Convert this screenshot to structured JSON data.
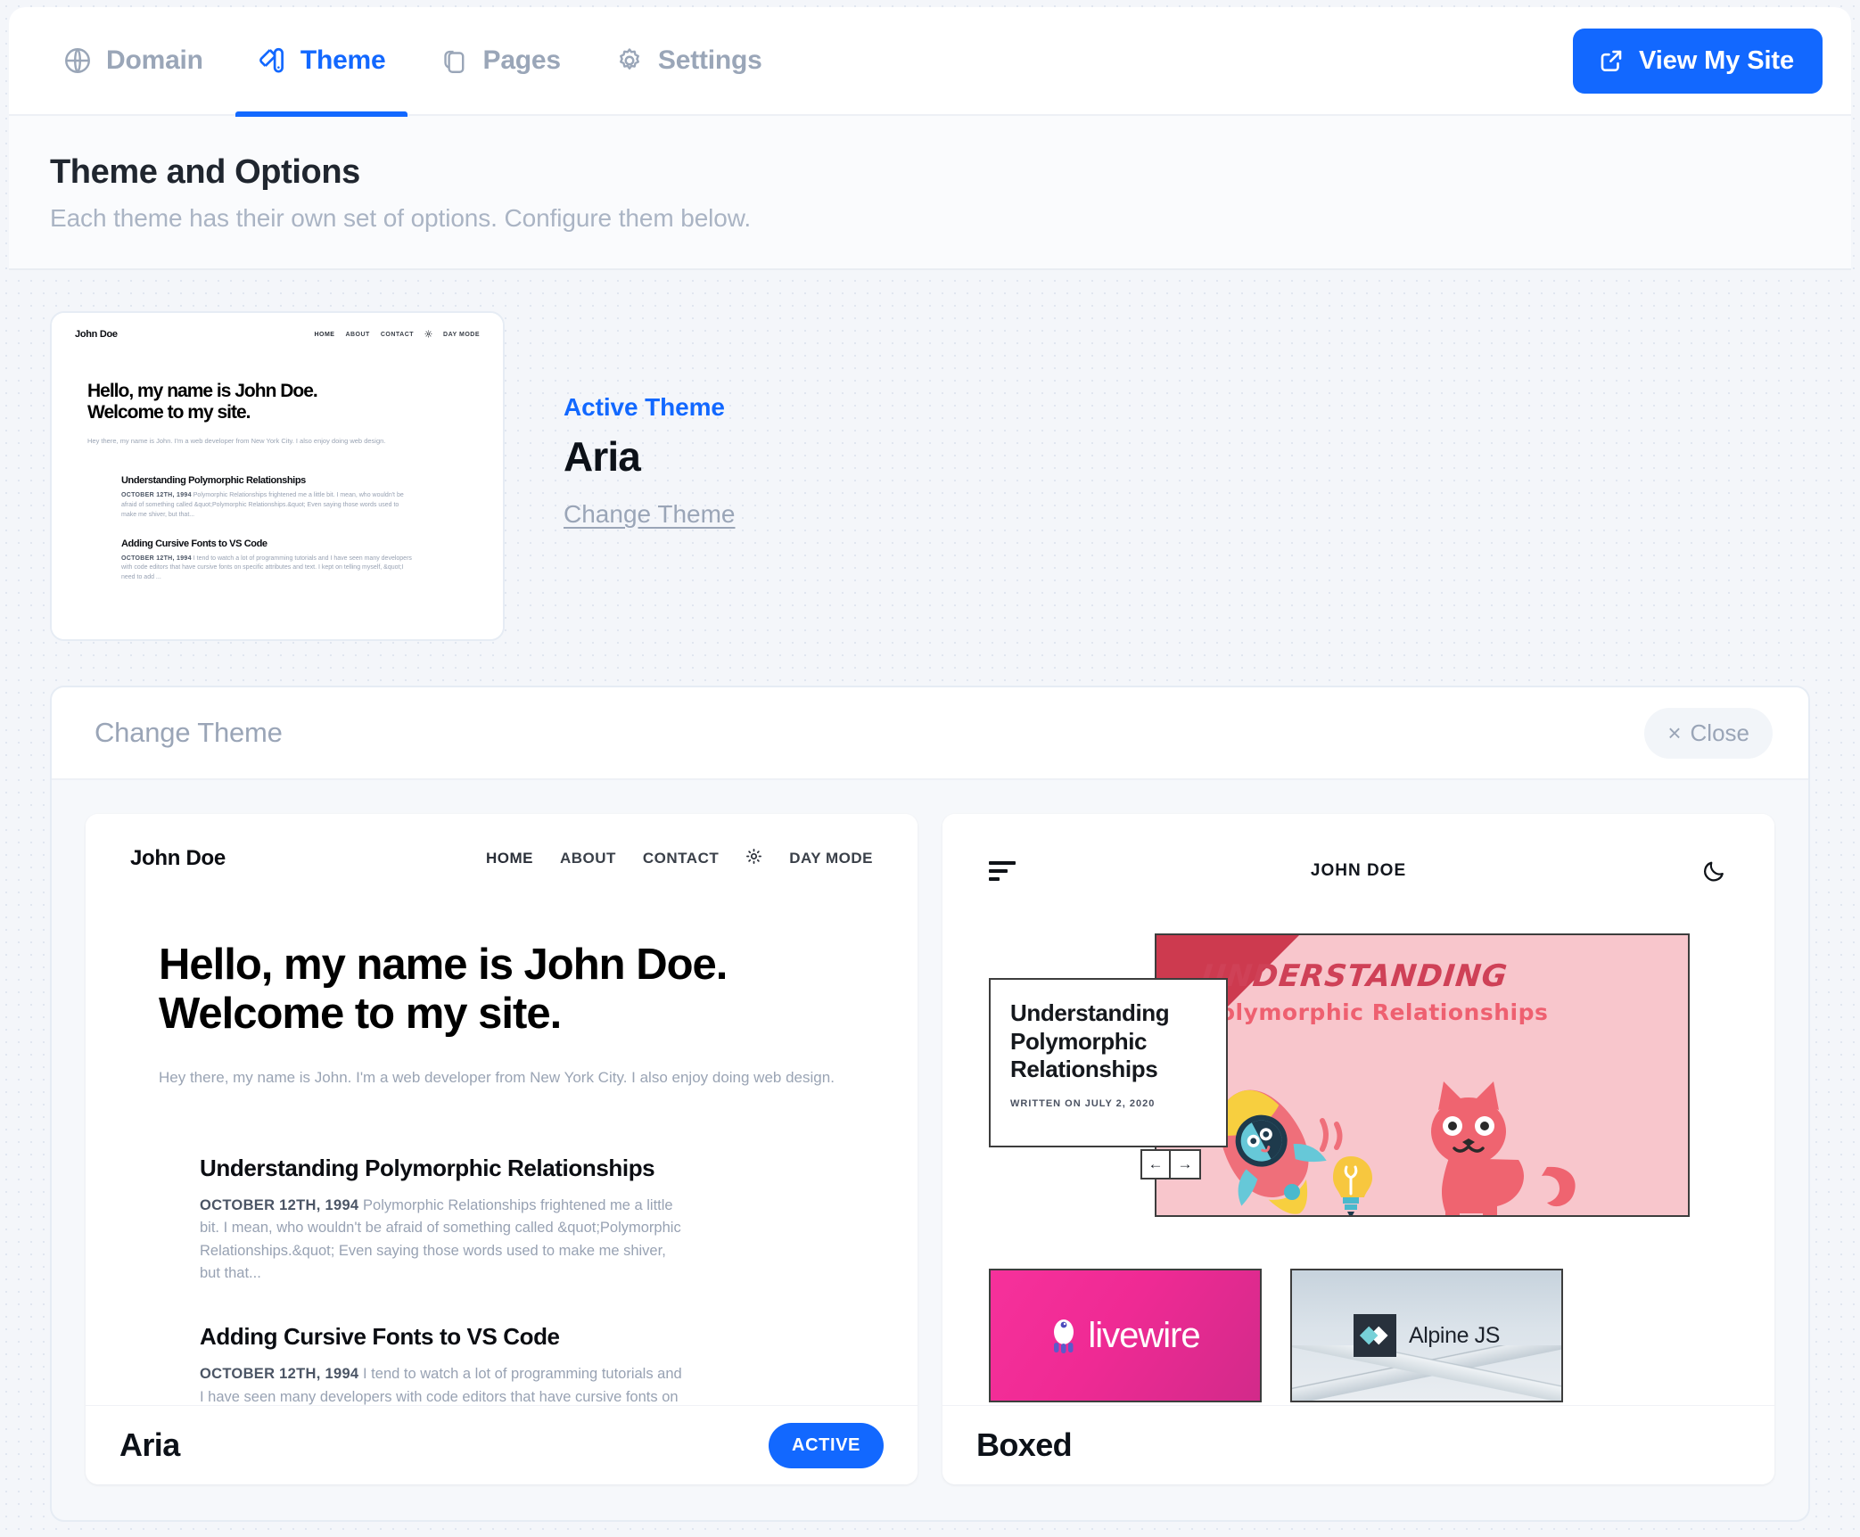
{
  "nav": {
    "tabs": [
      {
        "label": "Domain",
        "icon": "globe-icon",
        "active": false
      },
      {
        "label": "Theme",
        "icon": "palette-icon",
        "active": true
      },
      {
        "label": "Pages",
        "icon": "pages-icon",
        "active": false
      },
      {
        "label": "Settings",
        "icon": "gear-icon",
        "active": false
      }
    ],
    "view_site_label": "View My Site",
    "view_site_icon": "external-link-icon"
  },
  "header": {
    "title": "Theme and Options",
    "subtitle": "Each theme has their own set of options. Configure them below."
  },
  "active_theme": {
    "label": "Active Theme",
    "name": "Aria",
    "change_link": "Change Theme"
  },
  "panel": {
    "title": "Change Theme",
    "close_label": "Close",
    "close_icon": "close-icon"
  },
  "themes": [
    {
      "name": "Aria",
      "badge": "ACTIVE",
      "is_active": true
    },
    {
      "name": "Boxed",
      "badge": "",
      "is_active": false
    }
  ],
  "aria_preview": {
    "logo": "John Doe",
    "links": [
      "HOME",
      "ABOUT",
      "CONTACT"
    ],
    "mode_toggle": "DAY MODE",
    "mode_icon": "sun-icon",
    "heading_line1": "Hello, my name is John Doe.",
    "heading_line2": "Welcome to my site.",
    "intro": "Hey there, my name is John. I'm a web developer from New York City. I also enjoy doing web design.",
    "posts": [
      {
        "title": "Understanding Polymorphic Relationships",
        "date": "OCTOBER 12TH, 1994",
        "excerpt": "Polymorphic Relationships frightened me a little bit. I mean, who wouldn't be afraid of something called &quot;Polymorphic Relationships.&quot; Even saying those words used to make me shiver, but that..."
      },
      {
        "title": "Adding Cursive Fonts to VS Code",
        "date": "OCTOBER 12TH, 1994",
        "excerpt": "I tend to watch a lot of programming tutorials and I have seen many developers with code editors that have cursive fonts on specific attributes and text. I kept on telling myself, &quot;I need to add ..."
      }
    ]
  },
  "boxed_preview": {
    "site_title": "JOHN DOE",
    "menu_icon": "hamburger-icon",
    "dark_mode_icon": "moon-icon",
    "hero_image_title_line1": "UNDERSTANDING",
    "hero_image_title_line2": "Polymorphic Relationships",
    "card_title": "Understanding Polymorphic Relationships",
    "card_meta": "WRITTEN ON JULY 2, 2020",
    "prev_arrow": "←",
    "next_arrow": "→",
    "tiles": [
      {
        "name": "livewire",
        "kind": "livewire-tile"
      },
      {
        "name": "Alpine JS",
        "kind": "alpine-tile"
      }
    ]
  },
  "colors": {
    "accent": "#1268ff",
    "muted": "#9aa5b7",
    "page_bg": "#f4f6fa",
    "boxed_pink": "#f8c6cc",
    "boxed_red": "#cd3a4f",
    "livewire_pink": "#ef2a94"
  }
}
